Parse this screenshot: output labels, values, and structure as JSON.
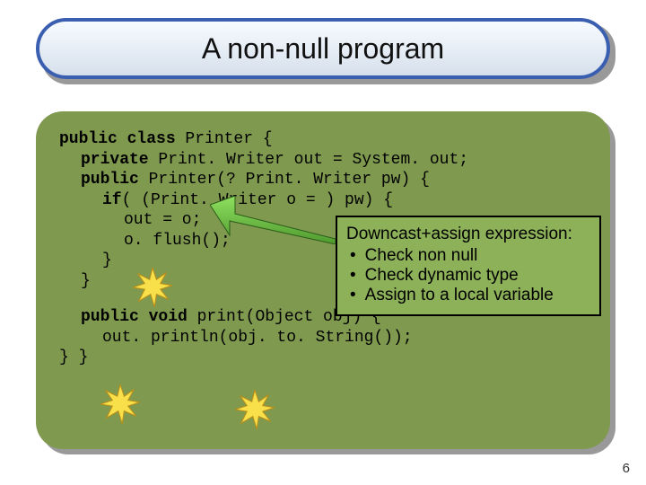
{
  "title": "A non-null program",
  "code": {
    "l1": {
      "kw1": "public class",
      "rest": " Printer {"
    },
    "l2": {
      "kw1": "private",
      "rest": " Print. Writer out = System. out;"
    },
    "l3": {
      "kw1": "public",
      "rest": " Printer(? Print. Writer pw) {"
    },
    "l4": {
      "kw1": "if",
      "rest": "( (Print. Writer o = ) pw) {"
    },
    "l5": "out = o;",
    "l6": "o. flush();",
    "l7": "}",
    "l8": "}",
    "l9": {
      "kw1": "public void",
      "rest": " print(Object obj) {"
    },
    "l10": "out. println(obj. to. String());",
    "l11": "} }"
  },
  "callout": {
    "heading": "Downcast+assign expression:",
    "items": [
      "Check non null",
      "Check dynamic type",
      "Assign to a local variable"
    ]
  },
  "colors": {
    "code_bg": "#7f9a4f",
    "callout_bg": "#8db158",
    "title_border": "#3a5fb0",
    "arrow_fill": "#6fbf44",
    "burst_fill": "#f7e04a"
  },
  "slide_number": "6"
}
